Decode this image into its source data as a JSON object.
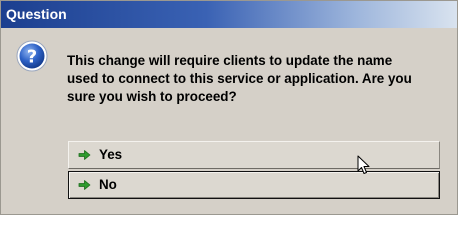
{
  "dialog": {
    "title": "Question",
    "icon": "question-icon",
    "message_lines": [
      "This change will require clients to update the name",
      "used to connect to this service or application.  Are you",
      "sure you wish to proceed?"
    ]
  },
  "buttons": {
    "yes": {
      "label": "Yes",
      "icon": "green-arrow-icon"
    },
    "no": {
      "label": "No",
      "icon": "green-arrow-icon"
    }
  },
  "colors": {
    "titlebar_start": "#1c3f8f",
    "titlebar_end": "#d9e3ef",
    "dialog_background": "#d5d0c8",
    "icon_blue": "#1f4fb4",
    "arrow_green": "#2e9b2e"
  }
}
